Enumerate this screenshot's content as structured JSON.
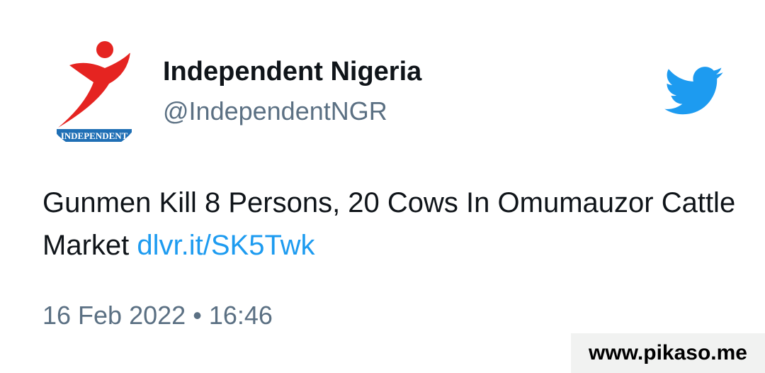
{
  "tweet": {
    "author_name": "Independent Nigeria",
    "author_handle": "@IndependentNGR",
    "avatar_logo_text": "INDEPENDENT",
    "text_prefix": "Gunmen Kill 8 Persons, 20 Cows In Omumauzor Cattle Market ",
    "link_text": "dlvr.it/SK5Twk",
    "date": "16 Feb 2022",
    "separator": "•",
    "time": "16:46"
  },
  "watermark": {
    "text": "www.pikaso.me"
  },
  "icons": {
    "brand": "twitter-bird-icon"
  },
  "colors": {
    "text_primary": "#0f1419",
    "text_secondary": "#5b7083",
    "link": "#1d9bf0",
    "twitter_blue": "#1d9bf0",
    "logo_red": "#e52421",
    "logo_blue": "#1f6fb5",
    "watermark_bg": "#f1f2f1"
  }
}
